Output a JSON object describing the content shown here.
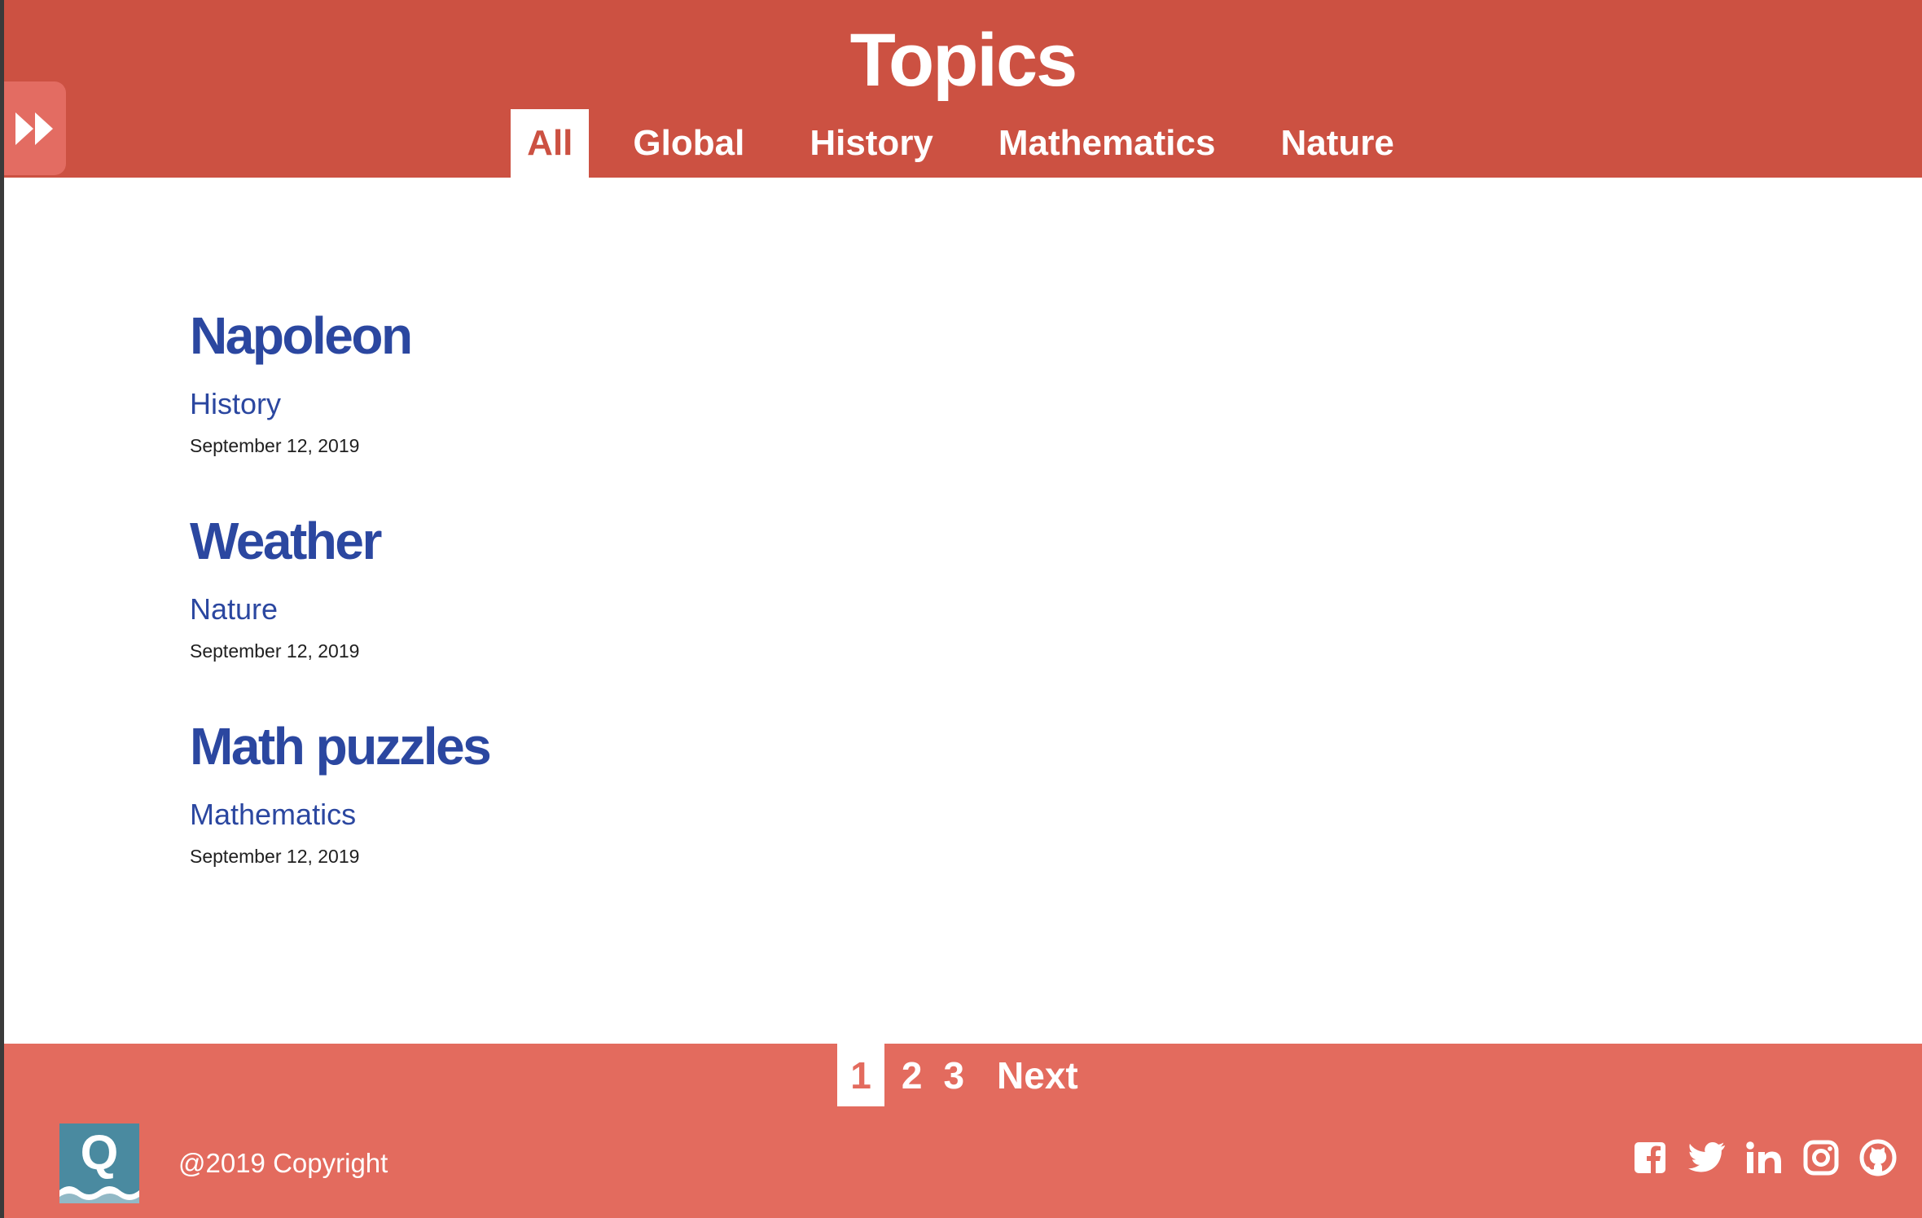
{
  "header": {
    "title": "Topics",
    "tabs": [
      {
        "label": "All",
        "active": true
      },
      {
        "label": "Global",
        "active": false
      },
      {
        "label": "History",
        "active": false
      },
      {
        "label": "Mathematics",
        "active": false
      },
      {
        "label": "Nature",
        "active": false
      }
    ],
    "sidebar_toggle_icon": "fast-forward-icon"
  },
  "posts": [
    {
      "title": "Napoleon",
      "category": "History",
      "date": "September 12, 2019"
    },
    {
      "title": "Weather",
      "category": "Nature",
      "date": "September 12, 2019"
    },
    {
      "title": "Math puzzles",
      "category": "Mathematics",
      "date": "September 12, 2019"
    }
  ],
  "footer": {
    "pagination": {
      "pages": [
        "1",
        "2",
        "3"
      ],
      "current": "1",
      "next_label": "Next"
    },
    "logo_letter": "Q",
    "copyright": "@2019 Copyright",
    "social_icons": [
      "facebook-icon",
      "twitter-icon",
      "linkedin-icon",
      "instagram-icon",
      "github-icon"
    ]
  },
  "colors": {
    "header_bg": "#cc5142",
    "footer_bg": "#e36b5e",
    "link_blue": "#2b47a0",
    "logo_bg": "#4a8aa0"
  }
}
